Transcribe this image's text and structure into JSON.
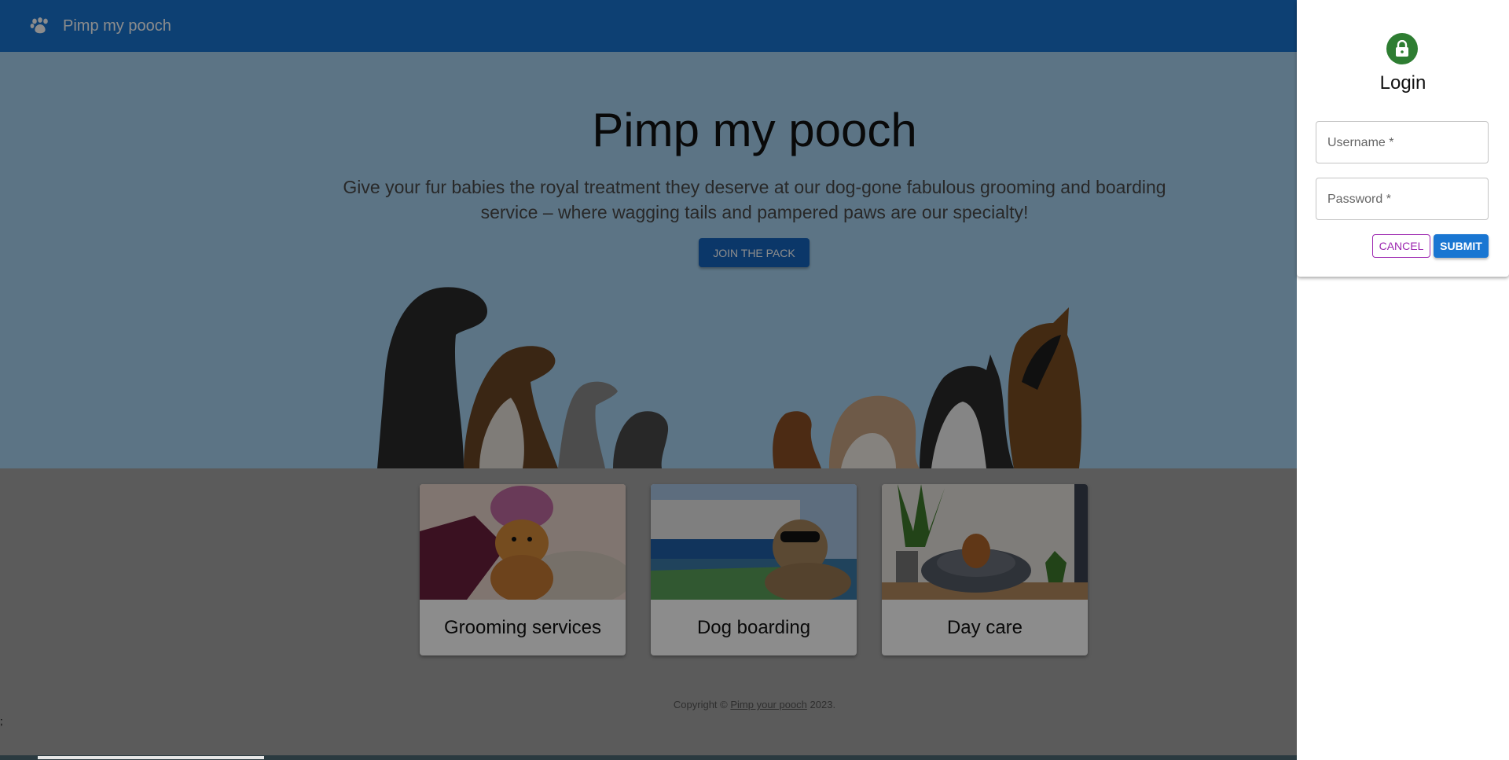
{
  "appbar": {
    "brand": "Pimp my pooch",
    "icon": "paw-icon"
  },
  "hero": {
    "title": "Pimp my pooch",
    "tagline": "Give your fur babies the royal treatment they deserve at our dog-gone fabulous grooming and boarding service – where wagging tails and pampered paws are our specialty!",
    "cta_label": "JOIN THE PACK"
  },
  "cards": [
    {
      "label": "Grooming services"
    },
    {
      "label": "Dog boarding"
    },
    {
      "label": "Day care"
    }
  ],
  "footer": {
    "prefix": "Copyright © ",
    "link": "Pimp your pooch",
    "suffix": " 2023."
  },
  "stray_text": ";",
  "login": {
    "icon": "lock-icon",
    "title": "Login",
    "username_placeholder": "Username *",
    "password_placeholder": "Password *",
    "cancel_label": "CANCEL",
    "submit_label": "SUBMIT"
  },
  "colors": {
    "appbar": "#1976d2",
    "hero_bg": "#a8d4f3",
    "cta": "#1565c0",
    "avatar": "#2e7d32",
    "cancel": "#9c27b0",
    "submit": "#1976d2"
  }
}
